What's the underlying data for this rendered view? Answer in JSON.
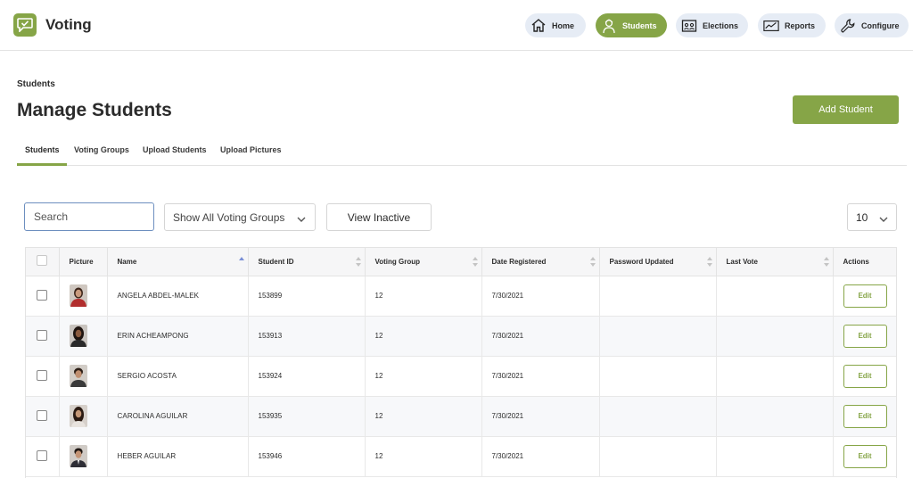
{
  "app": {
    "name": "Voting",
    "brand_color": "#86a547"
  },
  "nav": [
    {
      "label": "Home",
      "icon": "home-icon",
      "active": false
    },
    {
      "label": "Students",
      "icon": "student-icon",
      "active": true
    },
    {
      "label": "Elections",
      "icon": "ballot-icon",
      "active": false
    },
    {
      "label": "Reports",
      "icon": "chart-icon",
      "active": false
    },
    {
      "label": "Configure",
      "icon": "wrench-icon",
      "active": false
    }
  ],
  "page": {
    "breadcrumb": "Students",
    "title": "Manage Students",
    "add_button": "Add Student"
  },
  "tabs": [
    {
      "label": "Students",
      "active": true
    },
    {
      "label": "Voting Groups",
      "active": false
    },
    {
      "label": "Upload Students",
      "active": false
    },
    {
      "label": "Upload Pictures",
      "active": false
    }
  ],
  "filters": {
    "search_placeholder": "Search",
    "voting_groups_selected": "Show All Voting Groups",
    "view_inactive": "View Inactive",
    "page_size": "10"
  },
  "table": {
    "columns": [
      "Picture",
      "Name",
      "Student ID",
      "Voting Group",
      "Date Registered",
      "Password Updated",
      "Last Vote",
      "Actions"
    ],
    "rows": [
      {
        "name": "ANGELA ABDEL-MALEK",
        "student_id": "153899",
        "voting_group": "12",
        "date_registered": "7/30/2021",
        "password_updated": "",
        "last_vote": "",
        "action": "Edit"
      },
      {
        "name": "ERIN ACHEAMPONG",
        "student_id": "153913",
        "voting_group": "12",
        "date_registered": "7/30/2021",
        "password_updated": "",
        "last_vote": "",
        "action": "Edit"
      },
      {
        "name": "SERGIO ACOSTA",
        "student_id": "153924",
        "voting_group": "12",
        "date_registered": "7/30/2021",
        "password_updated": "",
        "last_vote": "",
        "action": "Edit"
      },
      {
        "name": "CAROLINA AGUILAR",
        "student_id": "153935",
        "voting_group": "12",
        "date_registered": "7/30/2021",
        "password_updated": "",
        "last_vote": "",
        "action": "Edit"
      },
      {
        "name": "HEBER AGUILAR",
        "student_id": "153946",
        "voting_group": "12",
        "date_registered": "7/30/2021",
        "password_updated": "",
        "last_vote": "",
        "action": "Edit"
      }
    ]
  }
}
